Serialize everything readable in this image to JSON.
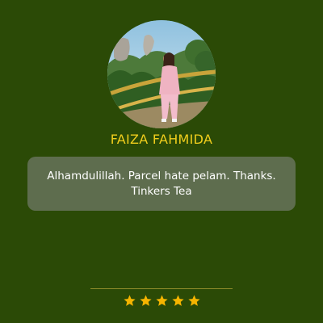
{
  "profile": {
    "name": "FAIZA FAHMIDA",
    "avatar_icon": "profile-photo"
  },
  "review": {
    "line1": "Alhamdulillah. Parcel hate pelam. Thanks.",
    "line2": "Tinkers Tea"
  },
  "rating": {
    "value": 5,
    "max": 5,
    "icon": "star-icon",
    "color": "#f5b400"
  },
  "colors": {
    "background": "#2b4a06",
    "name": "#f0cd1c",
    "quote_bg": "#5e6d4e",
    "quote_text": "#ffffff",
    "divider": "#8d8a2a"
  }
}
